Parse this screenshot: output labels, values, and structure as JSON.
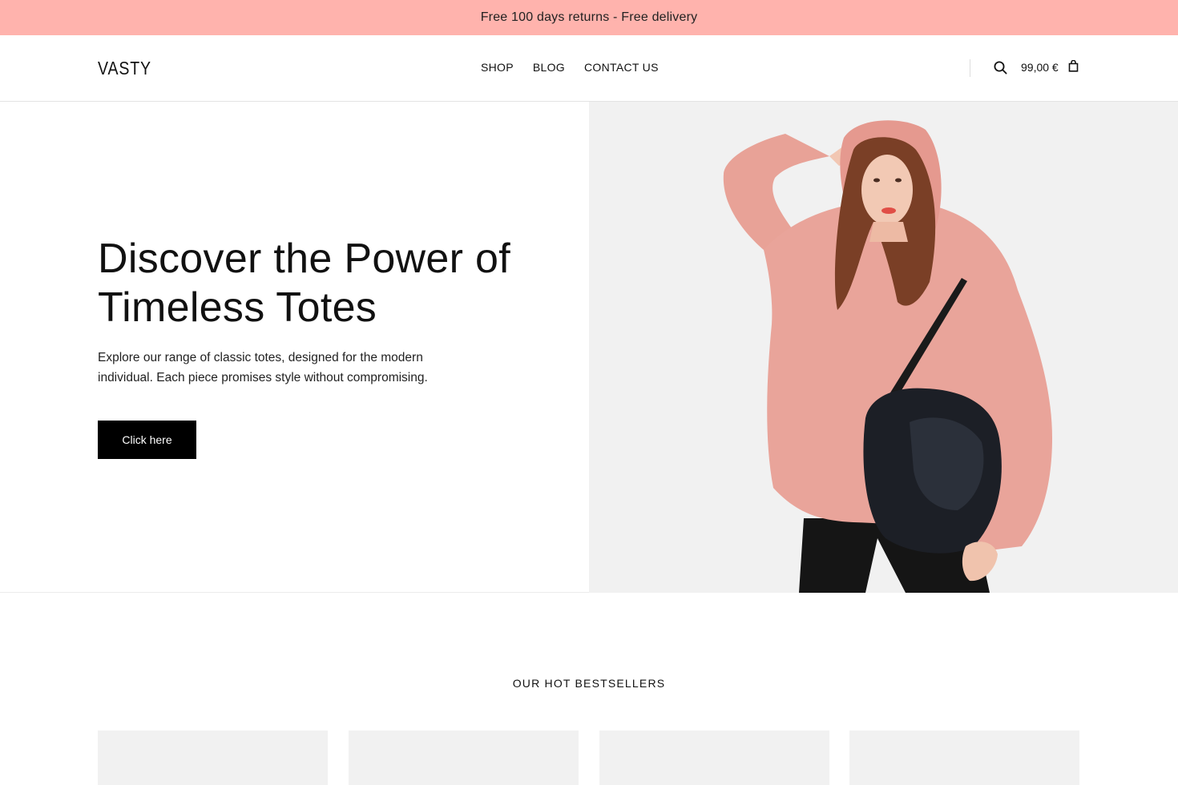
{
  "announcement": {
    "text": "Free 100 days returns - Free delivery"
  },
  "header": {
    "logo": "VASTY",
    "nav": [
      "SHOP",
      "BLOG",
      "CONTACT US"
    ],
    "cart_total": "99,00 €",
    "icons": {
      "search": "search-icon",
      "cart": "shopping-bag-icon"
    }
  },
  "hero": {
    "title": "Discover the Power of Timeless Totes",
    "text": "Explore our range of classic totes, designed for the modern individual. Each piece promises style without compromising.",
    "button_label": "Click here",
    "image": "woman in pink hoodie holding black leather bag"
  },
  "bestsellers": {
    "title": "OUR HOT BESTSELLERS",
    "card_count": 4
  },
  "colors": {
    "announcement_bg": "#ffb3ad",
    "button_bg": "#000000",
    "card_bg": "#f1f1f1",
    "hoodie": "#e9a49a"
  }
}
